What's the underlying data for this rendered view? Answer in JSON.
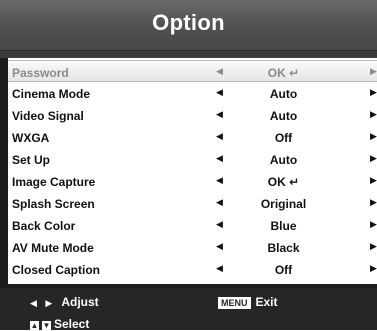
{
  "header": {
    "title": "Option"
  },
  "rows": [
    {
      "label": "Password",
      "value": "OK ↵"
    },
    {
      "label": "Cinema Mode",
      "value": "Auto"
    },
    {
      "label": "Video Signal",
      "value": "Auto"
    },
    {
      "label": "WXGA",
      "value": "Off"
    },
    {
      "label": "Set Up",
      "value": "Auto"
    },
    {
      "label": "Image Capture",
      "value": "OK ↵"
    },
    {
      "label": "Splash Screen",
      "value": "Original"
    },
    {
      "label": "Back Color",
      "value": "Blue"
    },
    {
      "label": "AV Mute Mode",
      "value": "Black"
    },
    {
      "label": "Closed Caption",
      "value": "Off"
    }
  ],
  "arrows": {
    "left": "◀",
    "right": "▶"
  },
  "footer": {
    "adjust_glyph": "◀ ▶",
    "adjust_label": "Adjust",
    "up_key": "▲",
    "down_key": "▼",
    "select_label": "Select",
    "menu_key": "MENU",
    "exit_label": "Exit"
  },
  "colors": {
    "header_bg": "#555555",
    "frame_bg": "#1c1c1c",
    "selected_text": "#8a8a8a",
    "row_text": "#111111"
  }
}
